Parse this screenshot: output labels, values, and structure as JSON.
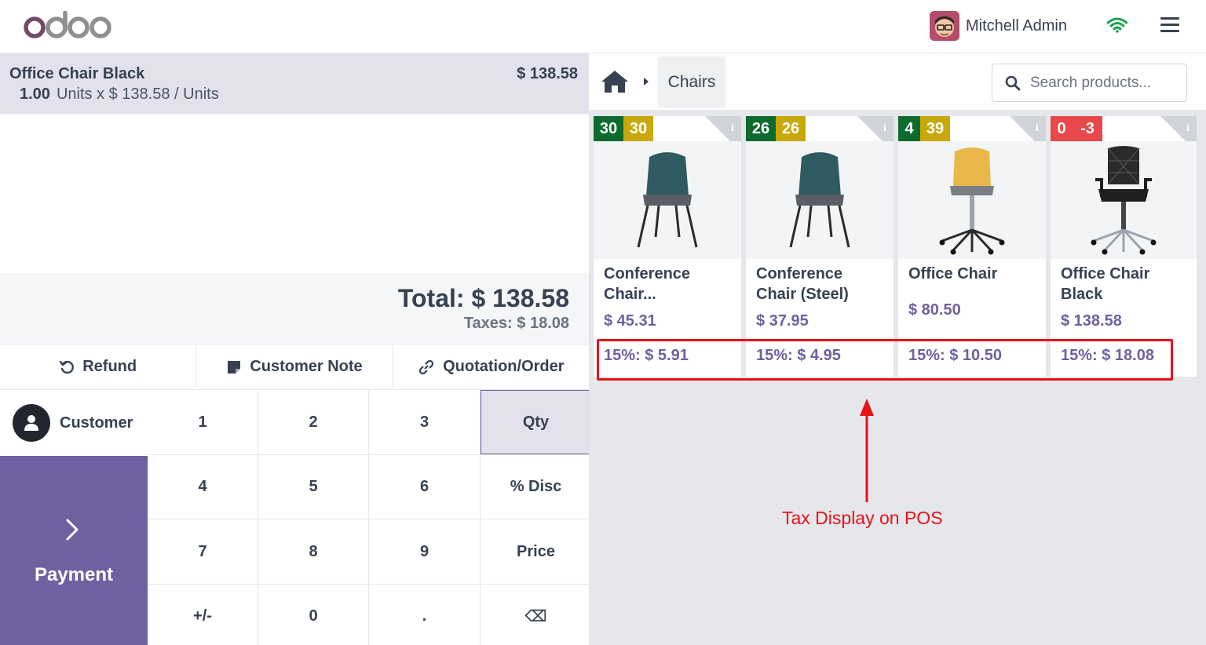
{
  "header": {
    "brand": "odoo",
    "user_name": "Mitchell Admin"
  },
  "order": {
    "line": {
      "product": "Office Chair Black",
      "price": "$ 138.58",
      "qty": "1.00",
      "detail": "Units x $ 138.58 / Units"
    },
    "total": "Total: $ 138.58",
    "taxes": "Taxes: $ 18.08"
  },
  "actions": {
    "refund": "Refund",
    "customer_note": "Customer Note",
    "quotation": "Quotation/Order"
  },
  "customer_label": "Customer",
  "payment_label": "Payment",
  "numpad": [
    "1",
    "2",
    "3",
    "Qty",
    "4",
    "5",
    "6",
    "% Disc",
    "7",
    "8",
    "9",
    "Price",
    "+/-",
    "0",
    ".",
    "⌫"
  ],
  "breadcrumb": {
    "category": "Chairs"
  },
  "search": {
    "placeholder": "Search products..."
  },
  "products": [
    {
      "badges": [
        "30",
        "30"
      ],
      "name": "Conference Chair...",
      "price": "$ 45.31",
      "tax": "15%: $ 5.91"
    },
    {
      "badges": [
        "26",
        "26"
      ],
      "name": "Conference Chair (Steel)",
      "price": "$ 37.95",
      "tax": "15%: $ 4.95"
    },
    {
      "badges": [
        "4",
        "39"
      ],
      "name": "Office Chair",
      "price": "$ 80.50",
      "tax": "15%: $ 10.50"
    },
    {
      "badges": [
        "0",
        "-3"
      ],
      "name": "Office Chair Black",
      "price": "$ 138.58",
      "tax": "15%: $ 18.08"
    }
  ],
  "annotation": "Tax Display on POS",
  "colors": {
    "accent": "#7060a0",
    "highlight": "#e8111a",
    "stock_green": "#0e6b2d",
    "stock_yellow": "#c9a80c",
    "stock_red": "#e8484a"
  }
}
